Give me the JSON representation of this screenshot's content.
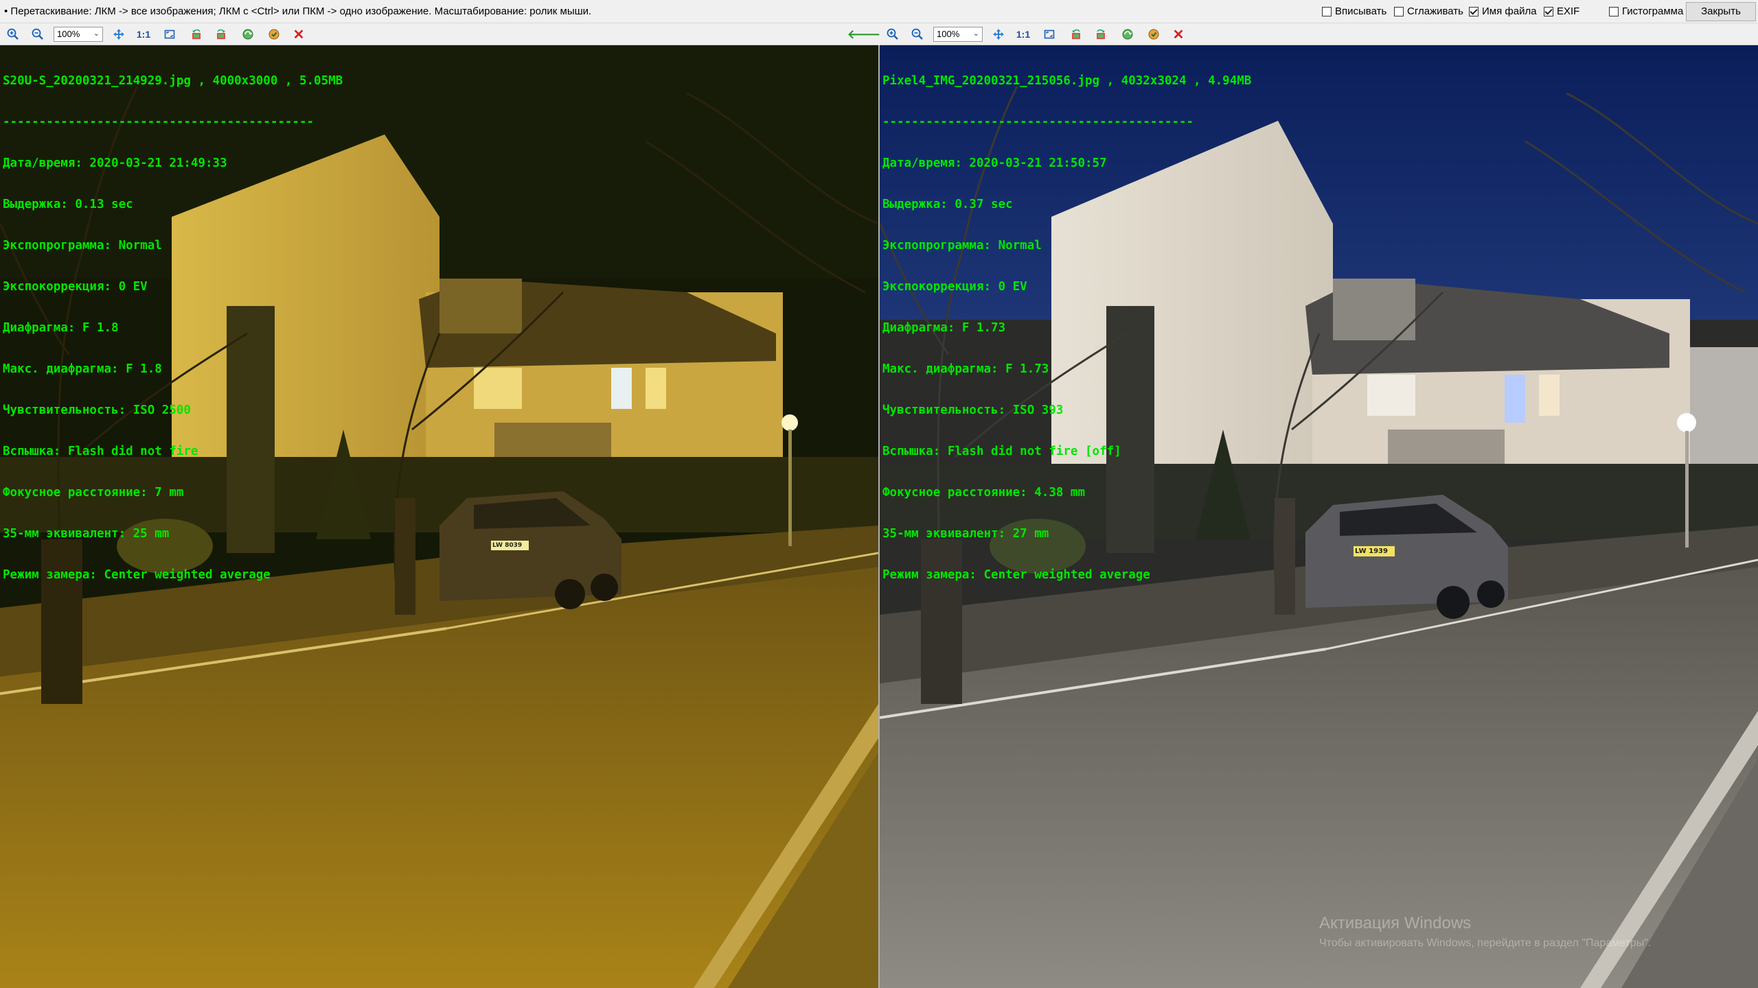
{
  "hint": "• Перетаскивание: ЛКМ -> все изображения; ЛКМ с <Ctrl> или ПКМ -> одно изображение. Масштабирование: ролик мыши.",
  "options": [
    {
      "label": "Вписывать",
      "checked": false
    },
    {
      "label": "Сглаживать",
      "checked": false
    },
    {
      "label": "Имя файла",
      "checked": true
    },
    {
      "label": "EXIF",
      "checked": true
    },
    {
      "label": "Гистограмма",
      "checked": false
    }
  ],
  "close_label": "Закрыть",
  "toolbar": {
    "zoom": "100%",
    "one_to_one": "1:1"
  },
  "left": {
    "header": "S20U-S_20200321_214929.jpg , 4000x3000 , 5.05MB",
    "separator": "-------------------------------------------",
    "exif": [
      "Дата/время: 2020-03-21 21:49:33",
      "Выдержка: 0.13 sec",
      "Экспопрограмма: Normal",
      "Экспокоррекция: 0 EV",
      "Диафрагма: F 1.8",
      "Макс. диафрагма: F 1.8",
      "Чувствительность: ISO 2500",
      "Вспышка: Flash did not fire",
      "Фокусное расстояние: 7 mm",
      "35-мм эквивалент: 25 mm",
      "Режим замера: Center weighted average"
    ],
    "plate": "LW 8039"
  },
  "right": {
    "header": "Pixel4_IMG_20200321_215056.jpg , 4032x3024 , 4.94MB",
    "separator": "-------------------------------------------",
    "exif": [
      "Дата/время: 2020-03-21 21:50:57",
      "Выдержка: 0.37 sec",
      "Экспопрограмма: Normal",
      "Экспокоррекция: 0 EV",
      "Диафрагма: F 1.73",
      "Макс. диафрагма: F 1.73",
      "Чувствительность: ISO 393",
      "Вспышка: Flash did not fire [off]",
      "Фокусное расстояние: 4.38 mm",
      "35-мм эквивалент: 27 mm",
      "Режим замера: Center weighted average"
    ],
    "plate": "LW 1939"
  },
  "watermark": {
    "title": "Активация Windows",
    "subtitle": "Чтобы активировать Windows, перейдите в раздел \"Параметры\"."
  },
  "colors": {
    "exif_text": "#00e600",
    "left_sky": "#141806",
    "right_sky": "#0a1e5a"
  }
}
